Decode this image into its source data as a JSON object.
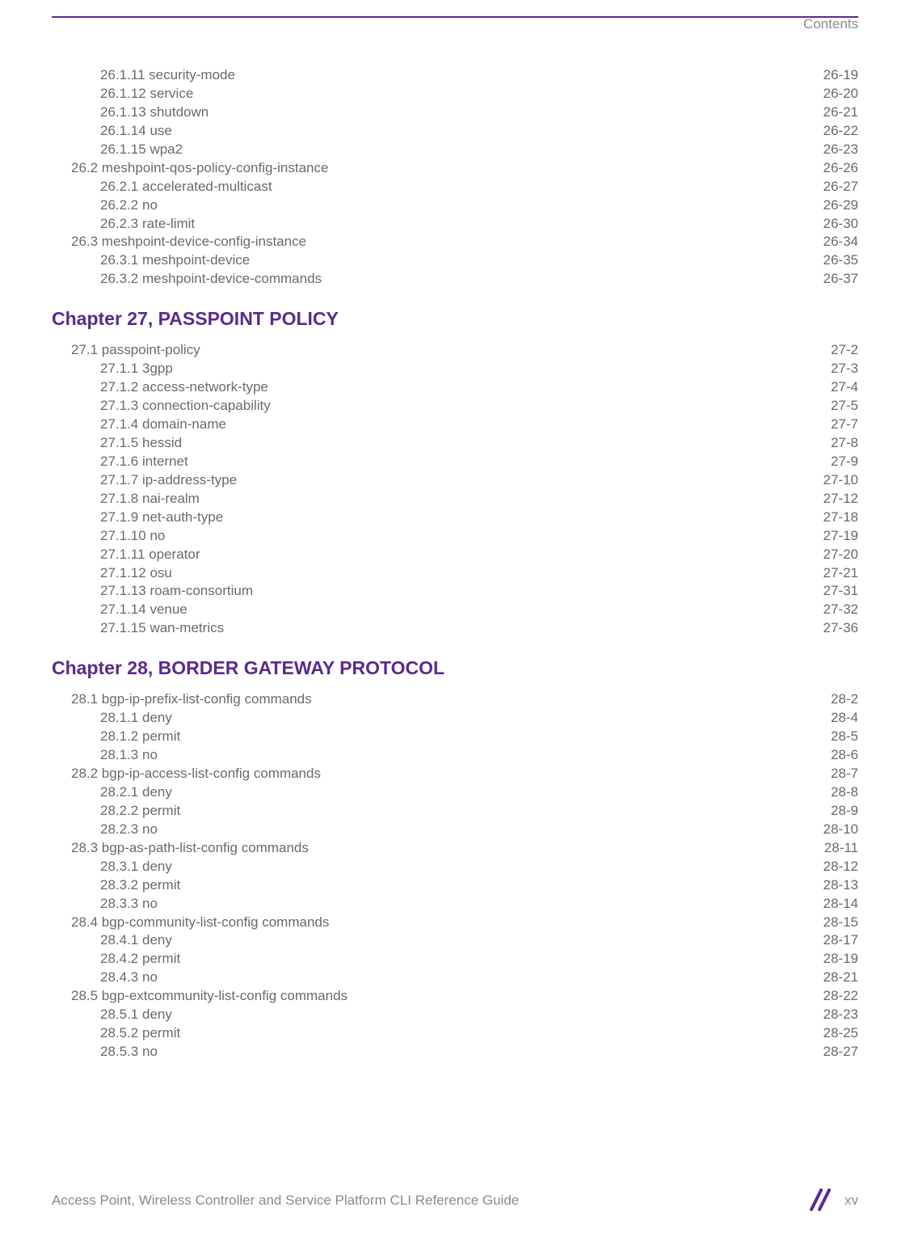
{
  "header": {
    "section_label": "Contents"
  },
  "footer": {
    "left_text": "Access Point, Wireless Controller and Service Platform CLI Reference Guide",
    "page_number": "xv"
  },
  "blocks": [
    {
      "type": "toc",
      "entries": [
        {
          "indent": 2,
          "label": "26.1.11  security-mode",
          "page": "26-19"
        },
        {
          "indent": 2,
          "label": "26.1.12  service",
          "page": "26-20"
        },
        {
          "indent": 2,
          "label": "26.1.13  shutdown",
          "page": "26-21"
        },
        {
          "indent": 2,
          "label": "26.1.14  use",
          "page": "26-22"
        },
        {
          "indent": 2,
          "label": "26.1.15  wpa2",
          "page": "26-23"
        },
        {
          "indent": 1,
          "label": "26.2  meshpoint-qos-policy-config-instance",
          "page": "26-26"
        },
        {
          "indent": 2,
          "label": "26.2.1  accelerated-multicast",
          "page": "26-27"
        },
        {
          "indent": 2,
          "label": "26.2.2  no",
          "page": "26-29"
        },
        {
          "indent": 2,
          "label": "26.2.3  rate-limit",
          "page": "26-30"
        },
        {
          "indent": 1,
          "label": "26.3  meshpoint-device-config-instance",
          "page": "26-34"
        },
        {
          "indent": 2,
          "label": "26.3.1  meshpoint-device",
          "page": "26-35"
        },
        {
          "indent": 2,
          "label": "26.3.2  meshpoint-device-commands",
          "page": "26-37"
        }
      ]
    },
    {
      "type": "chapter",
      "title": "Chapter 27, PASSPOINT POLICY"
    },
    {
      "type": "toc",
      "entries": [
        {
          "indent": 1,
          "label": "27.1  passpoint-policy",
          "page": "27-2"
        },
        {
          "indent": 2,
          "label": "27.1.1  3gpp",
          "page": "27-3"
        },
        {
          "indent": 2,
          "label": "27.1.2  access-network-type",
          "page": "27-4"
        },
        {
          "indent": 2,
          "label": "27.1.3  connection-capability",
          "page": "27-5"
        },
        {
          "indent": 2,
          "label": "27.1.4  domain-name",
          "page": "27-7"
        },
        {
          "indent": 2,
          "label": "27.1.5  hessid",
          "page": "27-8"
        },
        {
          "indent": 2,
          "label": "27.1.6  internet",
          "page": "27-9"
        },
        {
          "indent": 2,
          "label": "27.1.7  ip-address-type",
          "page": "27-10"
        },
        {
          "indent": 2,
          "label": "27.1.8  nai-realm",
          "page": "27-12"
        },
        {
          "indent": 2,
          "label": "27.1.9  net-auth-type",
          "page": "27-18"
        },
        {
          "indent": 2,
          "label": "27.1.10  no",
          "page": "27-19"
        },
        {
          "indent": 2,
          "label": "27.1.11  operator",
          "page": "27-20"
        },
        {
          "indent": 2,
          "label": "27.1.12  osu",
          "page": "27-21"
        },
        {
          "indent": 2,
          "label": "27.1.13  roam-consortium",
          "page": "27-31"
        },
        {
          "indent": 2,
          "label": "27.1.14  venue",
          "page": "27-32"
        },
        {
          "indent": 2,
          "label": "27.1.15  wan-metrics",
          "page": "27-36"
        }
      ]
    },
    {
      "type": "chapter",
      "title": "Chapter 28, BORDER GATEWAY PROTOCOL"
    },
    {
      "type": "toc",
      "entries": [
        {
          "indent": 1,
          "label": "28.1  bgp-ip-prefix-list-config commands",
          "page": "28-2"
        },
        {
          "indent": 2,
          "label": "28.1.1  deny",
          "page": "28-4"
        },
        {
          "indent": 2,
          "label": "28.1.2  permit",
          "page": "28-5"
        },
        {
          "indent": 2,
          "label": "28.1.3  no",
          "page": "28-6"
        },
        {
          "indent": 1,
          "label": "28.2  bgp-ip-access-list-config commands",
          "page": "28-7"
        },
        {
          "indent": 2,
          "label": "28.2.1  deny",
          "page": "28-8"
        },
        {
          "indent": 2,
          "label": "28.2.2  permit",
          "page": "28-9"
        },
        {
          "indent": 2,
          "label": "28.2.3  no",
          "page": "28-10"
        },
        {
          "indent": 1,
          "label": "28.3  bgp-as-path-list-config commands",
          "page": "28-11"
        },
        {
          "indent": 2,
          "label": "28.3.1  deny",
          "page": "28-12"
        },
        {
          "indent": 2,
          "label": "28.3.2  permit",
          "page": "28-13"
        },
        {
          "indent": 2,
          "label": "28.3.3  no",
          "page": "28-14"
        },
        {
          "indent": 1,
          "label": "28.4  bgp-community-list-config commands",
          "page": "28-15"
        },
        {
          "indent": 2,
          "label": "28.4.1  deny",
          "page": "28-17"
        },
        {
          "indent": 2,
          "label": "28.4.2  permit",
          "page": "28-19"
        },
        {
          "indent": 2,
          "label": "28.4.3  no",
          "page": "28-21"
        },
        {
          "indent": 1,
          "label": "28.5  bgp-extcommunity-list-config commands",
          "page": "28-22"
        },
        {
          "indent": 2,
          "label": "28.5.1  deny",
          "page": "28-23"
        },
        {
          "indent": 2,
          "label": "28.5.2  permit",
          "page": "28-25"
        },
        {
          "indent": 2,
          "label": "28.5.3  no",
          "page": "28-27"
        }
      ]
    }
  ]
}
